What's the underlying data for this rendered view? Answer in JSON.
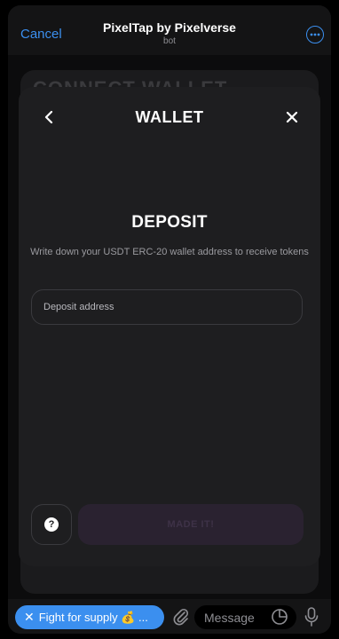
{
  "header": {
    "cancel_label": "Cancel",
    "title": "PixelTap by Pixelverse",
    "subtitle": "bot",
    "more_icon": "ellipsis-circle-icon"
  },
  "background_card": {
    "heading": "CONNECT WALLET"
  },
  "modal": {
    "title": "WALLET",
    "back_icon": "chevron-left-icon",
    "close_icon": "close-icon",
    "deposit_heading": "DEPOSIT",
    "description": "Write down your USDT ERC-20 wallet address to receive tokens",
    "input": {
      "placeholder": "Deposit address",
      "value": ""
    },
    "help_label": "?",
    "made_it_label": "MADE IT!"
  },
  "bottom_bar": {
    "fight_label": "Fight for supply 💰 ...",
    "message_placeholder": "Message",
    "attach_icon": "paperclip-icon",
    "sticker_icon": "sticker-icon",
    "mic_icon": "microphone-icon"
  },
  "colors": {
    "accent": "#3b8fef",
    "background": "#0f0f10",
    "modal": "#1e1e20",
    "disabled_button": "#2a2230"
  }
}
